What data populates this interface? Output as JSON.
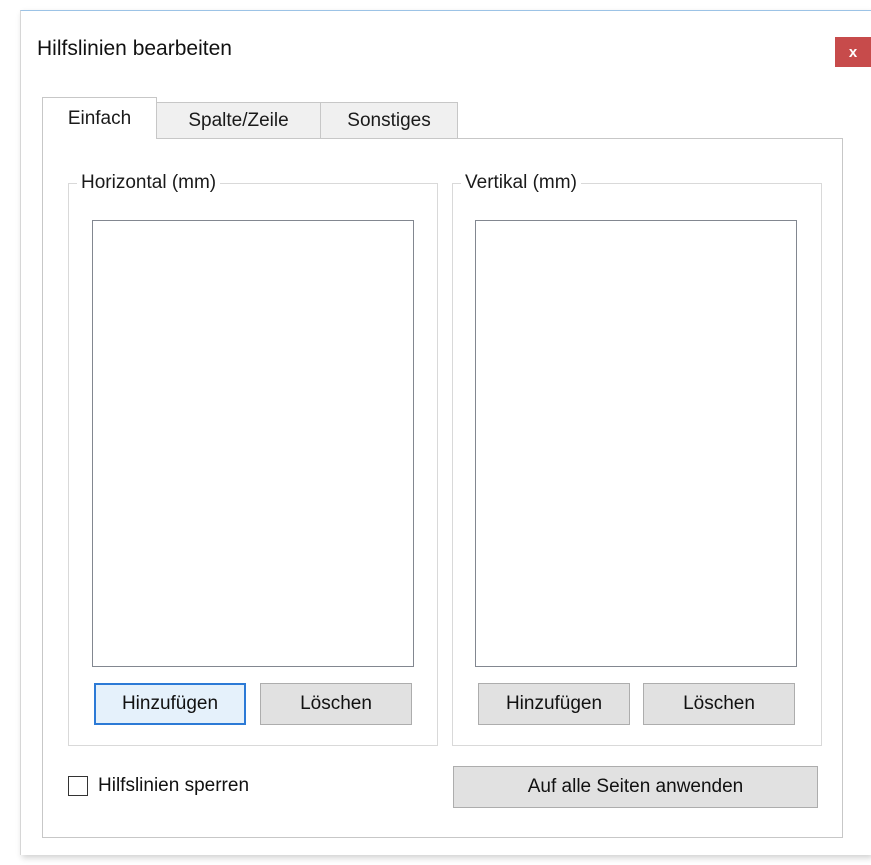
{
  "window": {
    "title": "Hilfslinien bearbeiten",
    "close_glyph": "x"
  },
  "tabs": [
    {
      "label": "Einfach",
      "active": true
    },
    {
      "label": "Spalte/Zeile",
      "active": false
    },
    {
      "label": "Sonstiges",
      "active": false
    }
  ],
  "horizontal": {
    "title": "Horizontal (mm)",
    "items": [],
    "add_label": "Hinzufügen",
    "delete_label": "Löschen"
  },
  "vertical": {
    "title": "Vertikal (mm)",
    "items": [],
    "add_label": "Hinzufügen",
    "delete_label": "Löschen"
  },
  "lock": {
    "label": "Hilfslinien sperren",
    "checked": false
  },
  "apply_all_label": "Auf alle Seiten anwenden",
  "colors": {
    "close_bg": "#c74b4b",
    "default_button_border": "#2c7ad6",
    "button_bg": "#e1e1e1"
  }
}
